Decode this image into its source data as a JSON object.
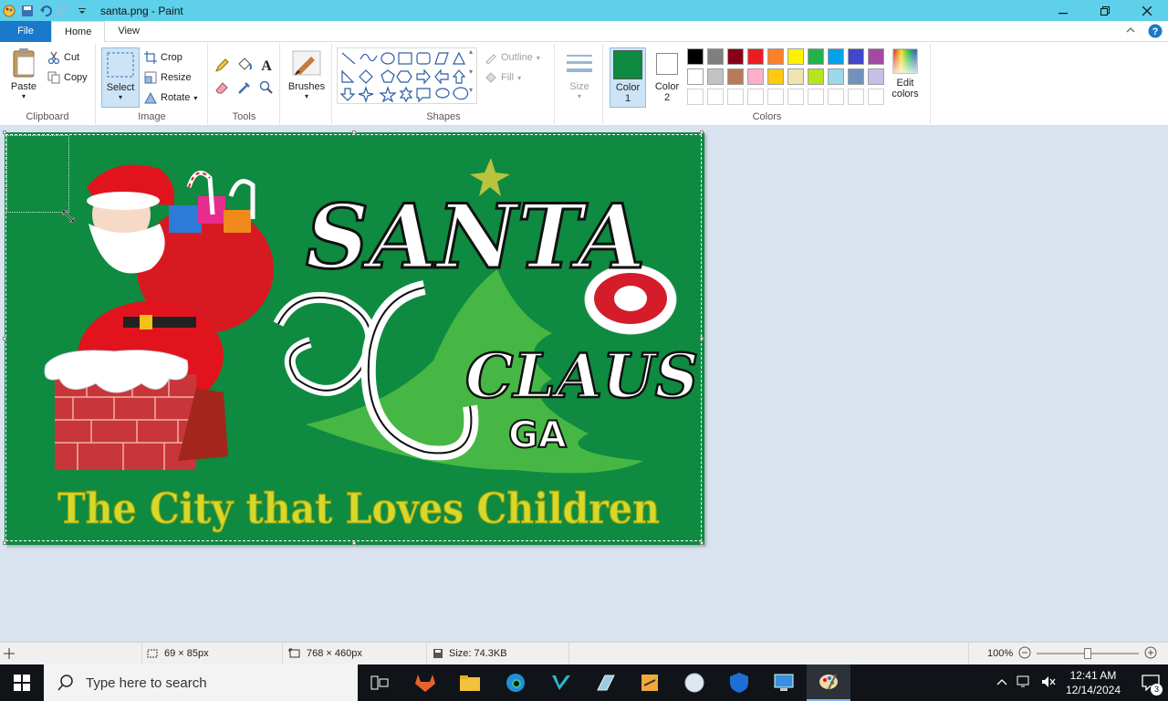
{
  "titlebar": {
    "title": "santa.png - Paint"
  },
  "tabs": {
    "file": "File",
    "home": "Home",
    "view": "View"
  },
  "clipboard": {
    "paste": "Paste",
    "cut": "Cut",
    "copy": "Copy",
    "label": "Clipboard"
  },
  "image": {
    "select": "Select",
    "crop": "Crop",
    "resize": "Resize",
    "rotate": "Rotate",
    "label": "Image"
  },
  "tools": {
    "label": "Tools"
  },
  "brushes": {
    "label": "Brushes"
  },
  "shapes": {
    "outline": "Outline",
    "fill": "Fill",
    "label": "Shapes"
  },
  "size": {
    "label": "Size"
  },
  "colors": {
    "color1": "Color",
    "color1_num": "1",
    "color2": "Color",
    "color2_num": "2",
    "edit1": "Edit",
    "edit2": "colors",
    "label": "Colors",
    "color1_value": "#0e8a41",
    "color2_value": "#ffffff",
    "palette_row1": [
      "#000000",
      "#7f7f7f",
      "#880015",
      "#ed1c24",
      "#ff7f27",
      "#fff200",
      "#22b14c",
      "#00a2e8",
      "#3f48cc",
      "#a349a4"
    ],
    "palette_row2": [
      "#ffffff",
      "#c3c3c3",
      "#b97a57",
      "#ffaec9",
      "#ffc90e",
      "#efe4b0",
      "#b5e61d",
      "#99d9ea",
      "#7092be",
      "#c8bfe7"
    ]
  },
  "canvas": {
    "title1": "SANTA",
    "title2": "CLAUS",
    "state": "GA",
    "slogan": "The City that Loves Children"
  },
  "status": {
    "selection_size": "69 × 85px",
    "image_size": "768 × 460px",
    "file_size": "Size: 74.3KB",
    "zoom": "100%",
    "zoom_level": 0.5
  },
  "taskbar": {
    "search_placeholder": "Type here to search",
    "time": "12:41 AM",
    "date": "12/14/2024",
    "notifications": "3"
  }
}
